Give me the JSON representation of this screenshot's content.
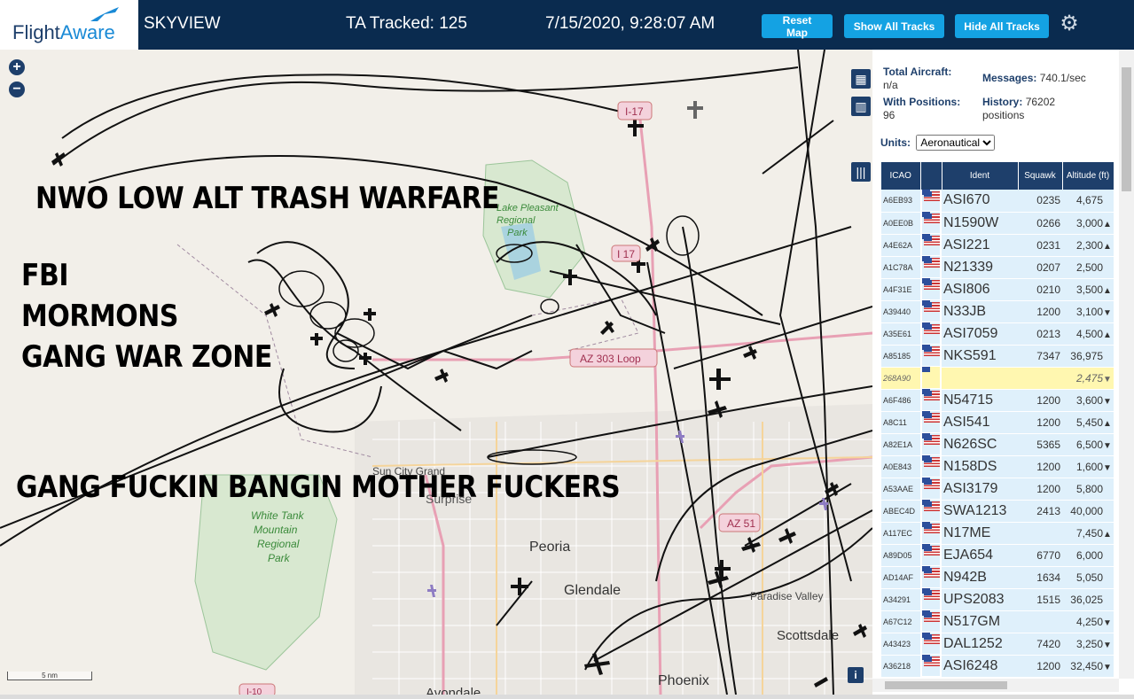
{
  "header": {
    "logo_text_a": "Flight",
    "logo_text_b": "Aware",
    "app_title": "SKYVIEW",
    "tracked": "TA Tracked: 125",
    "timestamp": "7/15/2020, 9:28:07 AM",
    "reset_map": "Reset Map",
    "show_all_tracks": "Show All Tracks",
    "hide_all_tracks": "Hide All Tracks",
    "gear_icon": "gear-icon"
  },
  "map": {
    "overlay_texts": [
      "NWO LOW ALT TRASH WARFARE",
      "FBI",
      "MORMONS",
      "GANG WAR ZONE",
      "GANG FUCKIN BANGIN MOTHER FUCKERS"
    ],
    "labels": {
      "i17_top": "I-17",
      "i17_mid": "I 17",
      "az303": "AZ 303 Loop",
      "az51": "AZ 51",
      "lake_pleasant_a": "Lake Pleasant",
      "lake_pleasant_b": "Regional",
      "lake_pleasant_c": "Park",
      "sun_city_grand": "Sun City Grand",
      "surprise": "Surprise",
      "white_tank_a": "White Tank",
      "white_tank_b": "Mountain",
      "white_tank_c": "Regional",
      "white_tank_d": "Park",
      "peoria": "Peoria",
      "glendale": "Glendale",
      "paradise_valley": "Paradise Valley",
      "scottsdale": "Scottsdale",
      "phoenix": "Phoenix",
      "avondale": "Avondale",
      "i10": "I-10"
    },
    "zoom_in": "+",
    "zoom_out": "−",
    "scale": "5 nm",
    "info": "i"
  },
  "panel": {
    "total_aircraft_label": "Total Aircraft:",
    "total_aircraft_value": "n/a",
    "messages_label": "Messages:",
    "messages_value": "740.1/sec",
    "with_positions_label": "With Positions:",
    "with_positions_value": "96",
    "history_label": "History:",
    "history_value": "76202",
    "history_unit": "positions",
    "units_label": "Units:",
    "units_selected": "Aeronautical",
    "columns": [
      "ICAO",
      "",
      "Ident",
      "Squawk",
      "Altitude (ft)"
    ],
    "rows": [
      {
        "icao": "A6EB93",
        "ident": "ASI670",
        "squawk": "0235",
        "alt": "4,675",
        "trend": ""
      },
      {
        "icao": "A0EE0B",
        "ident": "N1590W",
        "squawk": "0266",
        "alt": "3,000",
        "trend": "▲"
      },
      {
        "icao": "A4E62A",
        "ident": "ASI221",
        "squawk": "0231",
        "alt": "2,300",
        "trend": "▲"
      },
      {
        "icao": "A1C78A",
        "ident": "N21339",
        "squawk": "0207",
        "alt": "2,500",
        "trend": ""
      },
      {
        "icao": "A4F31E",
        "ident": "ASI806",
        "squawk": "0210",
        "alt": "3,500",
        "trend": "▲"
      },
      {
        "icao": "A39440",
        "ident": "N33JB",
        "squawk": "1200",
        "alt": "3,100",
        "trend": "▼"
      },
      {
        "icao": "A35E61",
        "ident": "ASI7059",
        "squawk": "0213",
        "alt": "4,500",
        "trend": "▲"
      },
      {
        "icao": "A85185",
        "ident": "NKS591",
        "squawk": "7347",
        "alt": "36,975",
        "trend": ""
      },
      {
        "icao": "268A90",
        "ident": "",
        "squawk": "",
        "alt": "2,475",
        "trend": "▼",
        "selected": true
      },
      {
        "icao": "A6F486",
        "ident": "N54715",
        "squawk": "1200",
        "alt": "3,600",
        "trend": "▼"
      },
      {
        "icao": "A8C11",
        "ident": "ASI541",
        "squawk": "1200",
        "alt": "5,450",
        "trend": "▲"
      },
      {
        "icao": "A82E1A",
        "ident": "N626SC",
        "squawk": "5365",
        "alt": "6,500",
        "trend": "▼"
      },
      {
        "icao": "A0E843",
        "ident": "N158DS",
        "squawk": "1200",
        "alt": "1,600",
        "trend": "▼"
      },
      {
        "icao": "A53AAE",
        "ident": "ASI3179",
        "squawk": "1200",
        "alt": "5,800",
        "trend": ""
      },
      {
        "icao": "ABEC4D",
        "ident": "SWA1213",
        "squawk": "2413",
        "alt": "40,000",
        "trend": ""
      },
      {
        "icao": "A117EC",
        "ident": "N17ME",
        "squawk": "",
        "alt": "7,450",
        "trend": "▲"
      },
      {
        "icao": "A89D05",
        "ident": "EJA654",
        "squawk": "6770",
        "alt": "6,000",
        "trend": ""
      },
      {
        "icao": "AD14AF",
        "ident": "N942B",
        "squawk": "1634",
        "alt": "5,050",
        "trend": ""
      },
      {
        "icao": "A34291",
        "ident": "UPS2083",
        "squawk": "1515",
        "alt": "36,025",
        "trend": ""
      },
      {
        "icao": "A67C12",
        "ident": "N517GM",
        "squawk": "",
        "alt": "4,250",
        "trend": "▼"
      },
      {
        "icao": "A43423",
        "ident": "DAL1252",
        "squawk": "7420",
        "alt": "3,250",
        "trend": "▼"
      },
      {
        "icao": "A36218",
        "ident": "ASI6248",
        "squawk": "1200",
        "alt": "32,450",
        "trend": "▼"
      }
    ]
  }
}
